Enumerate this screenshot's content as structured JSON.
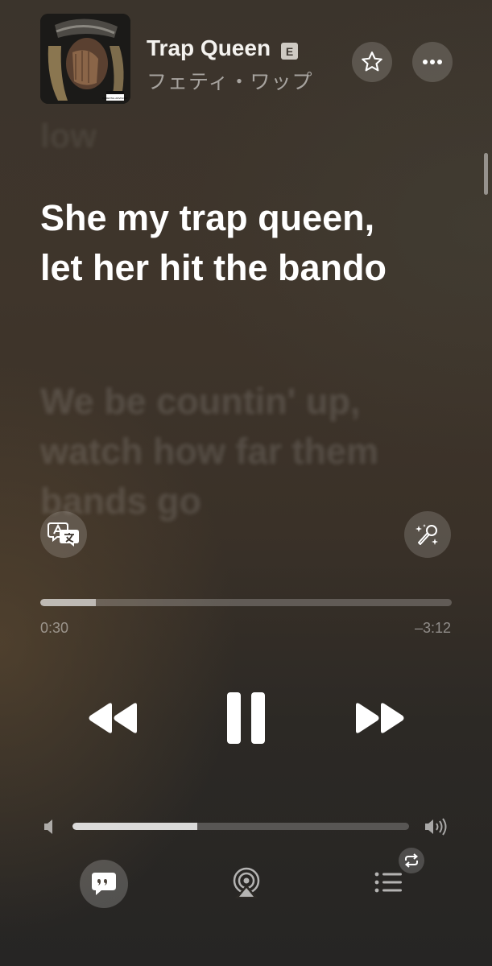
{
  "now_playing": {
    "title": "Trap Queen",
    "explicit_label": "E",
    "artist": "フェティ・ワップ",
    "album_art_label": "PARENTAL ADVISORY"
  },
  "header_actions": {
    "favorite_icon": "star-icon",
    "more_icon": "ellipsis-icon"
  },
  "lyrics": {
    "previous_line": "low",
    "current_line": "She my trap queen, let her hit the bando",
    "next_line": "We be countin' up, watch how far them bands go"
  },
  "lyric_tools": {
    "translate_icon": "translate-icon",
    "sing_icon": "microphone-sparkle-icon"
  },
  "playback": {
    "elapsed": "0:30",
    "remaining": "–3:12",
    "progress_fraction": 0.135,
    "state": "playing"
  },
  "volume": {
    "level_fraction": 0.37
  },
  "bottom_bar": {
    "lyrics_icon": "quote-bubble-icon",
    "airplay_icon": "airplay-icon",
    "queue_icon": "list-icon",
    "repeat_icon": "repeat-icon"
  },
  "colors": {
    "accent_text": "#ffffff",
    "secondary_text": "#8c847b"
  }
}
